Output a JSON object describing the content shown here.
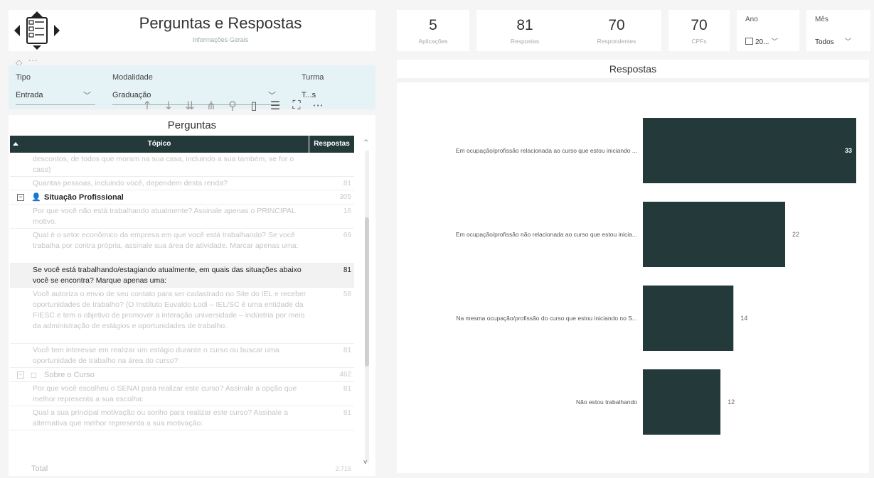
{
  "header": {
    "title": "Perguntas e Respostas",
    "subtitle": "Informações Gerais"
  },
  "filters": [
    {
      "label": "Tipo",
      "value": "Entrada"
    },
    {
      "label": "Modalidade",
      "value": "Graduação"
    },
    {
      "label": "Turma",
      "value": "T...s"
    }
  ],
  "kpis": [
    {
      "value": "5",
      "label": "Aplicações"
    },
    {
      "value": "81",
      "label": "Respostas"
    },
    {
      "value": "70",
      "label": "Respondentes"
    },
    {
      "value": "70",
      "label": "CPFs"
    }
  ],
  "slicers": [
    {
      "label": "Ano",
      "value": "20..."
    },
    {
      "label": "Mês",
      "value": "Todos"
    }
  ],
  "table": {
    "title": "Perguntas",
    "columns": [
      "Tópico",
      "Respostas"
    ],
    "rows": [
      {
        "kind": "item",
        "text": "descontos, de todos que moram na sua casa, incluindo a sua também, se for o caso)",
        "value": "",
        "lines": 2,
        "dim": true
      },
      {
        "kind": "item",
        "text": "Quantas pessoas, incluindo você, dependem desta renda?",
        "value": "81",
        "lines": 1,
        "dim": true
      },
      {
        "kind": "category",
        "text": "Situação Profissional",
        "value": "305",
        "icon": "user-icon",
        "dim": false
      },
      {
        "kind": "item",
        "text": "Por que você não está trabalhando atualmente? Assinale apenas o PRINCIPAL motivo.",
        "value": "16",
        "lines": 2,
        "dim": true
      },
      {
        "kind": "item",
        "text": "Qual é o setor econômico da empresa em que você está trabalhando? Se você trabalha por contra própria, assinale sua área de atividade. Marcar apenas uma:",
        "value": "69",
        "lines": 3,
        "dim": true
      },
      {
        "kind": "item",
        "text": "Se você está trabalhando/estagiando atualmente, em quais das situações abaixo você se encontra? Marque apenas uma:",
        "value": "81",
        "lines": 2,
        "dim": false,
        "highlight": true
      },
      {
        "kind": "item",
        "text": "Você autoriza o envio de seu contato para ser cadastrado no Site do IEL e receber oportunidades de trabalho? (O Instituto Euvaldo Lodi – IEL/SC é uma entidade da FIESC e tem o objetivo de promover a interação universidade – indústria por meio da administração de estágios e oportunidades de trabalho.",
        "value": "58",
        "lines": 5,
        "dim": true
      },
      {
        "kind": "item",
        "text": "Você tem interesse em realizar um estágio durante o curso ou buscar uma oportunidade de trabalho na área do curso?",
        "value": "81",
        "lines": 2,
        "dim": true
      },
      {
        "kind": "category",
        "text": "Sobre o Curso",
        "value": "462",
        "icon": "book-icon",
        "dim": true
      },
      {
        "kind": "item",
        "text": "Por que você escolheu o SENAI para realizar este curso? Assinale a opção que melhor representa a sua escolha:",
        "value": "81",
        "lines": 2,
        "dim": true
      },
      {
        "kind": "item",
        "text": "Qual a sua principal motivação ou sonho para realizar este curso? Assinale a alternativa que melhor representa a sua motivação:",
        "value": "81",
        "lines": 2,
        "dim": true
      }
    ],
    "total": {
      "label": "Total",
      "value": "2.715"
    }
  },
  "chart_data": {
    "type": "bar",
    "orientation": "horizontal",
    "title": "Respostas",
    "categories": [
      "Em ocupação/profissão relacionada ao curso que estou iniciando ...",
      "Em ocupação/profissão não relacionada ao curso que estou inicia...",
      "Na mesma ocupação/profissão do curso que estou iniciando no S...",
      "Não estou trabalhando"
    ],
    "values": [
      33,
      22,
      14,
      12
    ],
    "value_labels": [
      "33",
      "22",
      "14",
      "12"
    ],
    "xlim": [
      0,
      33
    ],
    "color": "#243a3a"
  },
  "colors": {
    "accent": "#243a3a",
    "filter_bg": "#e6f3f6"
  }
}
